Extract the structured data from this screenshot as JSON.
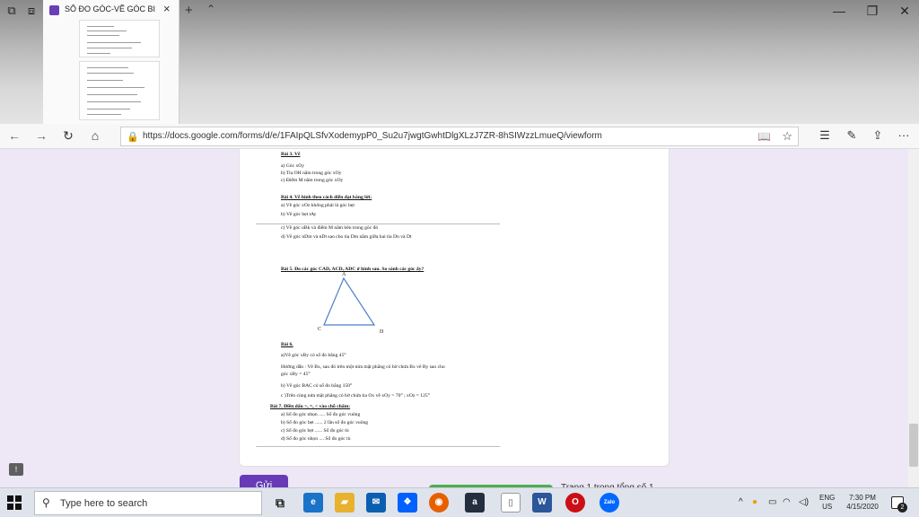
{
  "browser": {
    "tab": {
      "title": "SỐ ĐO GÓC-VẼ GÓC BI",
      "close_glyph": "×"
    },
    "new_tab_glyph": "+",
    "tab_preview_glyph": "⌃",
    "set_aside_glyph": "⧉",
    "tab_list_glyph": "⧈",
    "window": {
      "minimize": "—",
      "restore": "❐",
      "close": "✕"
    },
    "nav": {
      "back": "←",
      "forward": "→",
      "refresh": "↻",
      "home": "⌂"
    },
    "url": "https://docs.google.com/forms/d/e/1FAIpQLSfvXodemypP0_Su2u7jwgtGwhtDlgXLzJ7ZR-8hSIWzzLmueQ/viewform",
    "lock_glyph": "🔒",
    "reading_glyph": "📖",
    "favorite_glyph": "☆",
    "toolbar": {
      "favorites_hub": "☰",
      "notes": "✎",
      "share": "⇪",
      "more": "···"
    }
  },
  "document": {
    "lines": [
      {
        "text": "Bài 3. Vẽ",
        "bold": true
      },
      {
        "text": "a)  Góc xOy"
      },
      {
        "text": "b)  Tia OH nằm trong góc xOy"
      },
      {
        "text": "c)  Điểm M nằm trong góc xOy"
      },
      {
        "text": "Bài 4. Vẽ hình theo cách diễn đạt bằng lời:",
        "bold": true
      },
      {
        "text": "a)  Vẽ góc xOz không phải là góc bẹt"
      },
      {
        "text": "b)  Vẽ góc bẹt tAy"
      },
      {
        "text": "c)  Vẽ góc uBk và điểm M nằm bên trong góc đó"
      },
      {
        "text": "d)  Vẽ góc nDm và nDt sao cho tia Dm nằm giữa hai tia Dn và Dt"
      },
      {
        "text": "Bài 5. Đo các góc CAD,  ACD, ADC ở hình sau. So sánh các góc ấy?",
        "bold": true
      },
      {
        "text": "Bài 6.",
        "bold": true
      },
      {
        "text": "a)Vẽ góc xBy có số đo bằng  45°"
      },
      {
        "text": "Hướng dẫn : Vẽ Bx, sau đó trên một nửa mặt phẳng có bờ chứa Bx vẽ By sao cho"
      },
      {
        "text": "góc xBy = 45°"
      },
      {
        "text": "b) Vẽ góc BAC có số đo bằng 150°"
      },
      {
        "text": "c )Trên cùng nửa mặt phẳng có bờ chứa tia Ox vẽ xOy = 70° ; xOz = 125°"
      },
      {
        "text": "Bài 7. Điền dấu >, =, < vào chỗ chấm:",
        "bold": true
      },
      {
        "text": "a)  Số đo góc nhọn  ..... Số đo góc vuông"
      },
      {
        "text": "b)  Số đo góc bẹt ...... 2 lần số đo góc vuông"
      },
      {
        "text": "c)  Số đo góc bẹt ...... Số đo góc tù"
      },
      {
        "text": "d)  Số đo góc nhọn .... Số đo góc tù"
      }
    ],
    "triangle_labels": {
      "a": "A",
      "c": "C",
      "d": "D"
    }
  },
  "form": {
    "submit_label": "Gửi",
    "page_indicator": "Trang 1 trong tổng số 1",
    "progress_fraction": 1.0,
    "accent_color": "#673ab7",
    "feedback_glyph": "!"
  },
  "taskbar": {
    "search_placeholder": "Type here to search",
    "search_glyph": "⚲",
    "task_view_glyph": "⧉",
    "apps": [
      {
        "name": "edge",
        "glyph": "e",
        "color": "#1a73c9"
      },
      {
        "name": "file-explorer",
        "glyph": "▰",
        "color": "#e8b12e"
      },
      {
        "name": "mail",
        "glyph": "✉",
        "color": "#0b5fb0"
      },
      {
        "name": "dropbox",
        "glyph": "❖",
        "color": "#0061fe"
      },
      {
        "name": "firefox",
        "glyph": "◉",
        "color": "#e66000"
      },
      {
        "name": "amazon",
        "glyph": "a",
        "color": "#232f3e"
      },
      {
        "name": "blank-document",
        "glyph": "▯",
        "color": "#ffffff"
      },
      {
        "name": "word",
        "glyph": "W",
        "color": "#2b579a"
      },
      {
        "name": "opera",
        "glyph": "O",
        "color": "#cc0f16"
      },
      {
        "name": "zalo",
        "glyph": "Zalo",
        "color": "#0068ff"
      }
    ],
    "tray": {
      "chevron": "^",
      "lang_primary": "ENG",
      "lang_secondary": "US",
      "time": "7:30 PM",
      "date": "4/15/2020",
      "notifications": "2"
    }
  }
}
